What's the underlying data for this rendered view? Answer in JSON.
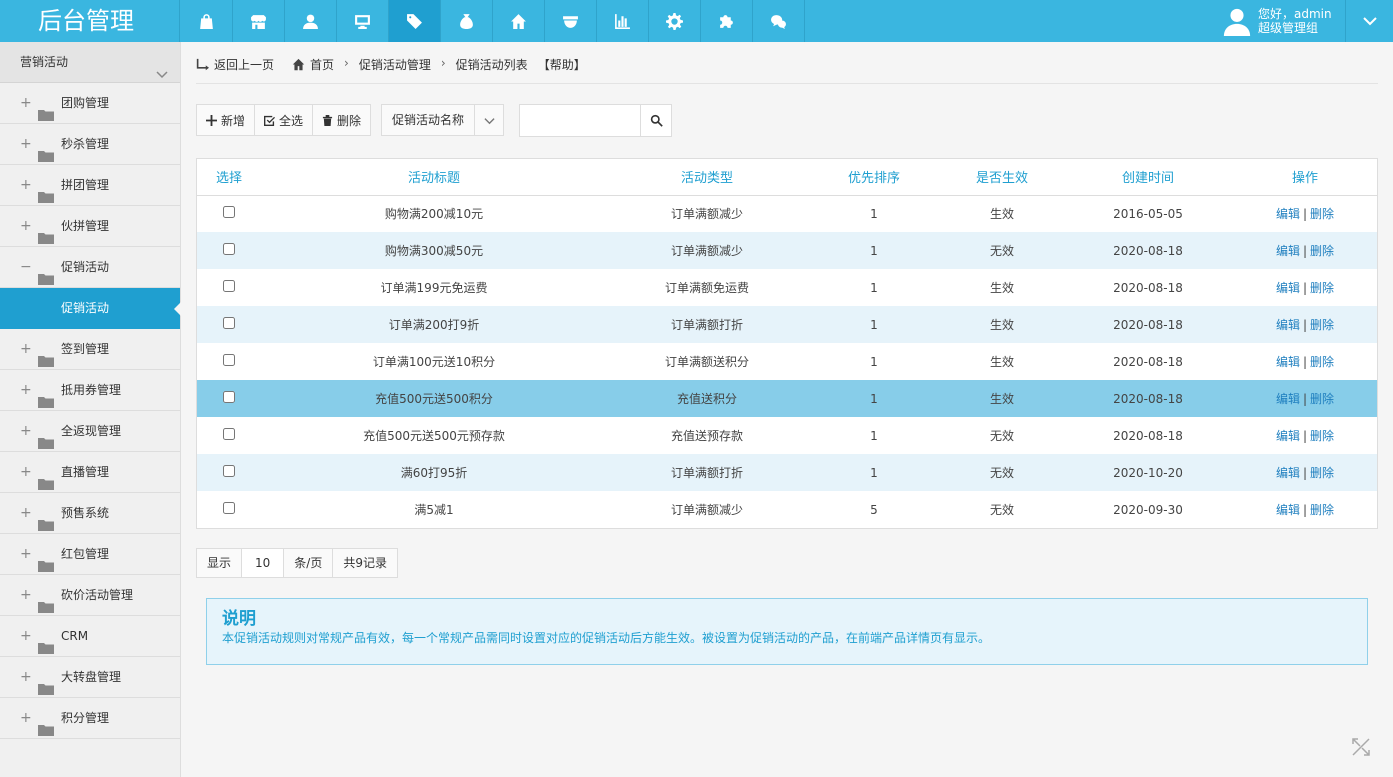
{
  "app": {
    "title": "后台管理"
  },
  "nav": {
    "items": [
      {
        "icon": "shopping-bag-icon"
      },
      {
        "icon": "store-icon"
      },
      {
        "icon": "user-icon"
      },
      {
        "icon": "monitor-icon"
      },
      {
        "icon": "tag-icon",
        "active": true
      },
      {
        "icon": "money-bag-icon"
      },
      {
        "icon": "home-icon"
      },
      {
        "icon": "bowl-icon"
      },
      {
        "icon": "bar-chart-icon"
      },
      {
        "icon": "gear-icon"
      },
      {
        "icon": "puzzle-icon"
      },
      {
        "icon": "wechat-icon"
      }
    ]
  },
  "user": {
    "greeting": "您好，admin",
    "role": "超级管理组"
  },
  "sidebar": {
    "section": "营销活动",
    "items": [
      {
        "label": "团购管理",
        "sign": "+"
      },
      {
        "label": "秒杀管理",
        "sign": "+"
      },
      {
        "label": "拼团管理",
        "sign": "+"
      },
      {
        "label": "伙拼管理",
        "sign": "+"
      },
      {
        "label": "促销活动",
        "sign": "−"
      },
      {
        "label": "签到管理",
        "sign": "+"
      },
      {
        "label": "抵用券管理",
        "sign": "+"
      },
      {
        "label": "全返现管理",
        "sign": "+"
      },
      {
        "label": "直播管理",
        "sign": "+"
      },
      {
        "label": "预售系统",
        "sign": "+"
      },
      {
        "label": "红包管理",
        "sign": "+"
      },
      {
        "label": "砍价活动管理",
        "sign": "+"
      },
      {
        "label": "CRM",
        "sign": "+"
      },
      {
        "label": "大转盘管理",
        "sign": "+"
      },
      {
        "label": "积分管理",
        "sign": "+"
      }
    ],
    "active_sub": "促销活动"
  },
  "breadcrumb": {
    "back": "返回上一页",
    "home": "首页",
    "level1": "促销活动管理",
    "level2": "促销活动列表",
    "help": "【帮助】"
  },
  "toolbar": {
    "add": "新增",
    "select_all": "全选",
    "delete": "删除",
    "filter_field": "促销活动名称",
    "search_value": ""
  },
  "table": {
    "headers": [
      "选择",
      "活动标题",
      "活动类型",
      "优先排序",
      "是否生效",
      "创建时间",
      "操作"
    ],
    "rows": [
      {
        "title": "购物满200减10元",
        "type": "订单满额减少",
        "priority": "1",
        "active": "生效",
        "created": "2016-05-05"
      },
      {
        "title": "购物满300减50元",
        "type": "订单满额减少",
        "priority": "1",
        "active": "无效",
        "created": "2020-08-18"
      },
      {
        "title": "订单满199元免运费",
        "type": "订单满额免运费",
        "priority": "1",
        "active": "生效",
        "created": "2020-08-18"
      },
      {
        "title": "订单满200打9折",
        "type": "订单满额打折",
        "priority": "1",
        "active": "生效",
        "created": "2020-08-18"
      },
      {
        "title": "订单满100元送10积分",
        "type": "订单满额送积分",
        "priority": "1",
        "active": "生效",
        "created": "2020-08-18"
      },
      {
        "title": "充值500元送500积分",
        "type": "充值送积分",
        "priority": "1",
        "active": "生效",
        "created": "2020-08-18",
        "highlight": true
      },
      {
        "title": "充值500元送500元预存款",
        "type": "充值送预存款",
        "priority": "1",
        "active": "无效",
        "created": "2020-08-18"
      },
      {
        "title": "满60打95折",
        "type": "订单满额打折",
        "priority": "1",
        "active": "无效",
        "created": "2020-10-20"
      },
      {
        "title": "满5减1",
        "type": "订单满额减少",
        "priority": "5",
        "active": "无效",
        "created": "2020-09-30"
      }
    ],
    "edit_label": "编辑",
    "delete_label": "删除",
    "op_separator": "|"
  },
  "pager": {
    "show": "显示",
    "size": "10",
    "unit": "条/页",
    "total": "共9记录"
  },
  "note": {
    "title": "说明",
    "text": "本促销活动规则对常规产品有效，每一个常规产品需同时设置对应的促销活动后方能生效。被设置为促销活动的产品，在前端产品详情页有显示。"
  },
  "colors": {
    "brand": "#3ab6e0",
    "active": "#1f9fd0",
    "row_alt": "#e6f3fa",
    "row_highlight": "#87cde9"
  }
}
